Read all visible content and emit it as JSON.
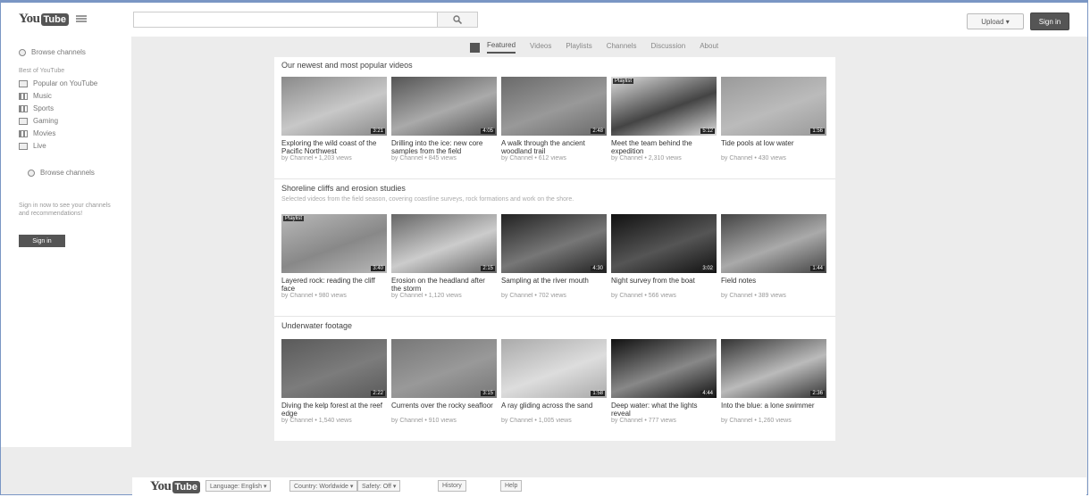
{
  "colors": {
    "frame": "#7a96c4",
    "background": "#ececec",
    "accent": "#555555"
  },
  "masthead": {
    "logo_you": "You",
    "logo_tube": "Tube",
    "search_icon": "search-icon",
    "upload_label": "Upload ▾",
    "sign_in_label": "Sign in"
  },
  "sidebar": {
    "top_item": "Browse channels",
    "heading": "Best of YouTube",
    "items": [
      "Popular on YouTube",
      "Music",
      "Sports",
      "Gaming",
      "Movies",
      "Live"
    ],
    "browse_label": "Browse channels",
    "promo_text": "Sign in now to see your channels and recommendations!",
    "sign_in_label": "Sign in"
  },
  "tabs": [
    "Featured",
    "Videos",
    "Playlists",
    "Channels",
    "Discussion",
    "About"
  ],
  "shelves": [
    {
      "title": "Our newest and most popular videos",
      "description": "",
      "videos": [
        {
          "title": "Exploring the wild coast of the Pacific Northwest",
          "meta": "by Channel  •  1,203 views",
          "duration": "3:21",
          "badge": ""
        },
        {
          "title": "Drilling into the ice: new core samples from the field",
          "meta": "by Channel  •  845 views",
          "duration": "4:05",
          "badge": ""
        },
        {
          "title": "A walk through the ancient woodland trail",
          "meta": "by Channel  •  612 views",
          "duration": "2:48",
          "badge": ""
        },
        {
          "title": "Meet the team behind the expedition",
          "meta": "by Channel  •  2,310 views",
          "duration": "5:12",
          "badge": "Playlist"
        },
        {
          "title": "Tide pools at low water",
          "meta": "by Channel  •  430 views",
          "duration": "1:56",
          "badge": ""
        }
      ]
    },
    {
      "title": "Shoreline cliffs and erosion studies",
      "description": "Selected videos from the field season, covering coastline surveys, rock formations and work on the shore.",
      "videos": [
        {
          "title": "Layered rock: reading the cliff face",
          "meta": "by Channel  •  980 views",
          "duration": "3:40",
          "badge": "Playlist"
        },
        {
          "title": "Erosion on the headland after the storm",
          "meta": "by Channel  •  1,120 views",
          "duration": "2:15",
          "badge": ""
        },
        {
          "title": "Sampling at the river mouth",
          "meta": "by Channel  •  702 views",
          "duration": "4:30",
          "badge": ""
        },
        {
          "title": "Night survey from the boat",
          "meta": "by Channel  •  566 views",
          "duration": "3:02",
          "badge": ""
        },
        {
          "title": "Field notes",
          "meta": "by Channel  •  389 views",
          "duration": "1:44",
          "badge": ""
        }
      ]
    },
    {
      "title": "Underwater footage",
      "description": "",
      "videos": [
        {
          "title": "Diving the kelp forest at the reef edge",
          "meta": "by Channel  •  1,540 views",
          "duration": "2:22",
          "badge": ""
        },
        {
          "title": "Currents over the rocky seafloor",
          "meta": "by Channel  •  910 views",
          "duration": "3:15",
          "badge": ""
        },
        {
          "title": "A ray gliding across the sand",
          "meta": "by Channel  •  1,005 views",
          "duration": "1:58",
          "badge": ""
        },
        {
          "title": "Deep water: what the lights reveal",
          "meta": "by Channel  •  777 views",
          "duration": "4:44",
          "badge": ""
        },
        {
          "title": "Into the blue: a lone swimmer",
          "meta": "by Channel  •  1,260 views",
          "duration": "2:36",
          "badge": ""
        }
      ]
    }
  ],
  "footer": {
    "logo_you": "You",
    "logo_tube": "Tube",
    "language": "Language: English ▾",
    "location": "Country: Worldwide ▾",
    "safety": "Safety: Off ▾",
    "history": "History",
    "help": "Help"
  }
}
